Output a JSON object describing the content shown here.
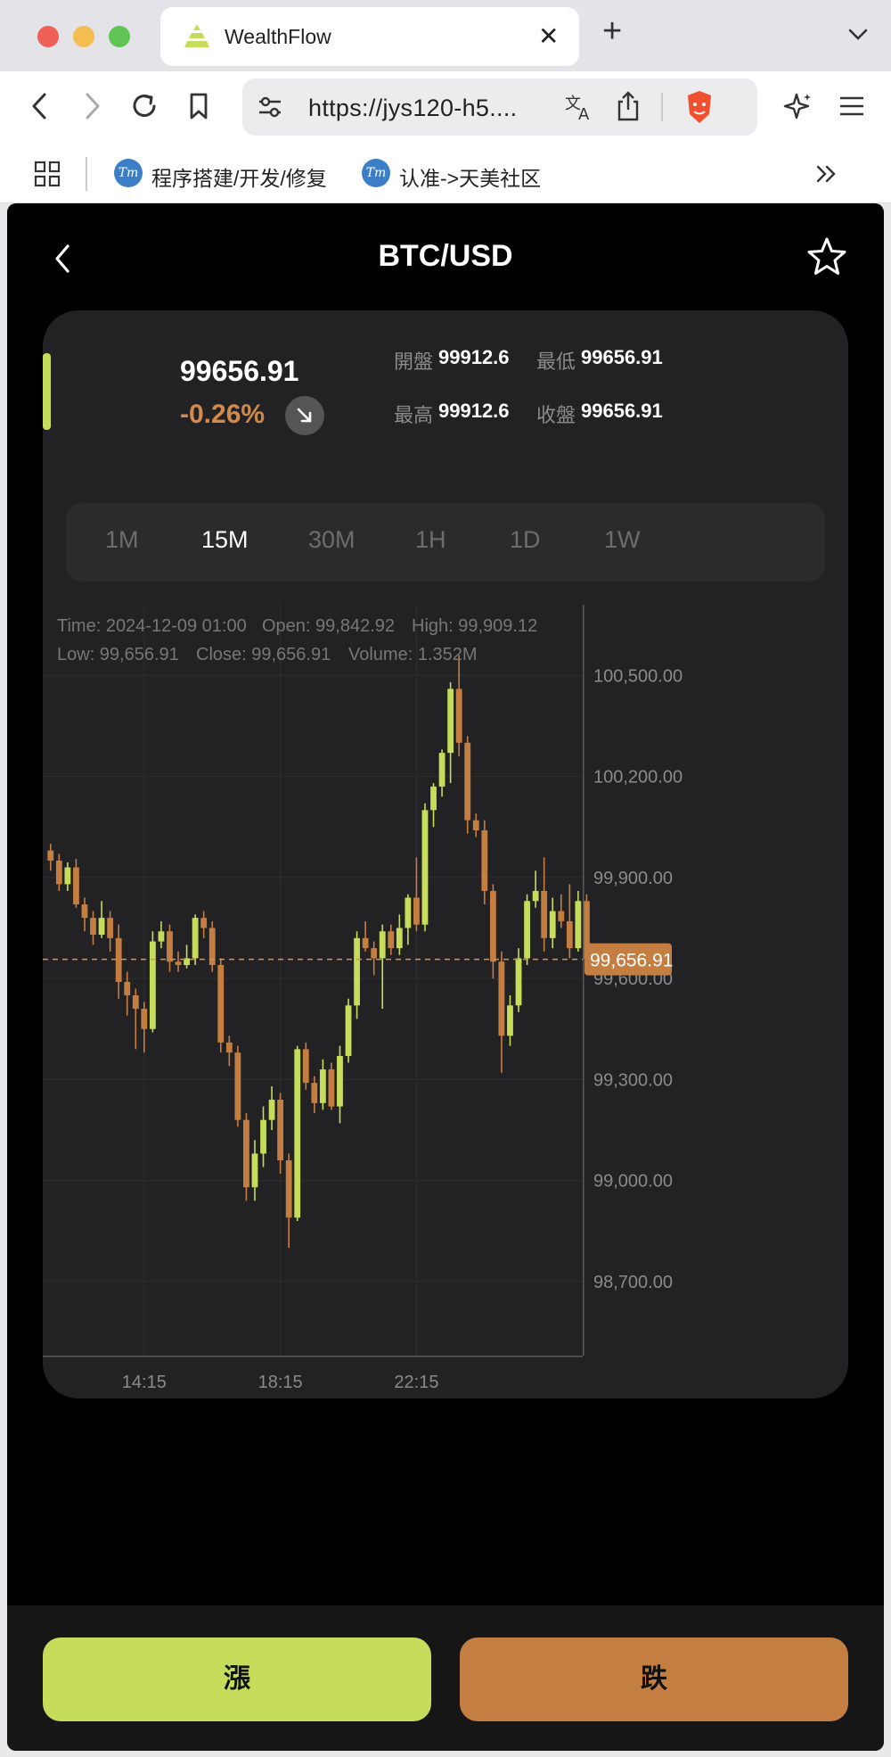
{
  "browser": {
    "tab_title": "WealthFlow",
    "url": "https://jys120-h5....",
    "bookmarks": [
      "程序搭建/开发/修复",
      "认准->天美社区"
    ],
    "bookmark_icon_text": "Tm"
  },
  "header": {
    "title": "BTC/USD"
  },
  "ticker": {
    "price": "99656.91",
    "change_pct": "-0.26%",
    "open_label": "開盤",
    "open_value": "99912.6",
    "low_label": "最低",
    "low_value": "99656.91",
    "high_label": "最高",
    "high_value": "99912.6",
    "close_label": "收盤",
    "close_value": "99656.91",
    "up_color": "#c5dd5a",
    "down_color": "#c57e42"
  },
  "timeframes": [
    "1M",
    "15M",
    "30M",
    "1H",
    "1D",
    "1W"
  ],
  "active_timeframe": "15M",
  "chart_info": {
    "time": "Time: 2024-12-09 01:00",
    "open": "Open: 99,842.92",
    "high": "High: 99,909.12",
    "low": "Low: 99,656.91",
    "close": "Close: 99,656.91",
    "volume": "Volume: 1.352M"
  },
  "chart_data": {
    "type": "candlestick",
    "y_ticks": [
      "100,500.00",
      "100,200.00",
      "99,900.00",
      "99,600.00",
      "99,300.00",
      "99,000.00",
      "98,700.00"
    ],
    "x_ticks": [
      "14:15",
      "18:15",
      "22:15"
    ],
    "ylim": [
      98480,
      100710
    ],
    "last_price": 99656.91,
    "last_price_label": "99,656.91",
    "candles": [
      [
        99980,
        99950,
        100000,
        99920
      ],
      [
        99950,
        99880,
        99970,
        99860
      ],
      [
        99880,
        99930,
        99945,
        99860
      ],
      [
        99930,
        99820,
        99955,
        99810
      ],
      [
        99820,
        99780,
        99840,
        99740
      ],
      [
        99780,
        99730,
        99800,
        99700
      ],
      [
        99730,
        99780,
        99830,
        99720
      ],
      [
        99780,
        99720,
        99800,
        99680
      ],
      [
        99720,
        99590,
        99760,
        99540
      ],
      [
        99590,
        99550,
        99620,
        99490
      ],
      [
        99550,
        99510,
        99570,
        99390
      ],
      [
        99510,
        99450,
        99530,
        99380
      ],
      [
        99450,
        99710,
        99740,
        99440
      ],
      [
        99710,
        99740,
        99770,
        99690
      ],
      [
        99740,
        99650,
        99760,
        99620
      ],
      [
        99650,
        99640,
        99680,
        99620
      ],
      [
        99640,
        99660,
        99700,
        99630
      ],
      [
        99660,
        99780,
        99790,
        99640
      ],
      [
        99780,
        99750,
        99800,
        99720
      ],
      [
        99750,
        99640,
        99770,
        99620
      ],
      [
        99640,
        99410,
        99660,
        99380
      ],
      [
        99410,
        99380,
        99430,
        99340
      ],
      [
        99380,
        99180,
        99400,
        99160
      ],
      [
        99180,
        98980,
        99200,
        98940
      ],
      [
        98980,
        99080,
        99120,
        98940
      ],
      [
        99080,
        99180,
        99220,
        99040
      ],
      [
        99180,
        99240,
        99280,
        99150
      ],
      [
        99240,
        99060,
        99260,
        99020
      ],
      [
        99060,
        98890,
        99080,
        98800
      ],
      [
        98890,
        99390,
        99400,
        98880
      ],
      [
        99390,
        99290,
        99410,
        99270
      ],
      [
        99290,
        99230,
        99310,
        99200
      ],
      [
        99230,
        99330,
        99360,
        99210
      ],
      [
        99330,
        99220,
        99350,
        99210
      ],
      [
        99220,
        99370,
        99400,
        99170
      ],
      [
        99370,
        99520,
        99540,
        99350
      ],
      [
        99520,
        99720,
        99740,
        99480
      ],
      [
        99720,
        99690,
        99770,
        99680
      ],
      [
        99690,
        99660,
        99710,
        99610
      ],
      [
        99660,
        99740,
        99760,
        99510
      ],
      [
        99740,
        99690,
        99760,
        99670
      ],
      [
        99690,
        99750,
        99790,
        99670
      ],
      [
        99750,
        99840,
        99850,
        99700
      ],
      [
        99840,
        99760,
        99960,
        99740
      ],
      [
        99760,
        100100,
        100120,
        99740
      ],
      [
        100100,
        100170,
        100180,
        100050
      ],
      [
        100170,
        100270,
        100280,
        100140
      ],
      [
        100270,
        100460,
        100480,
        100180
      ],
      [
        100460,
        100300,
        100560,
        100260
      ],
      [
        100300,
        100070,
        100320,
        100030
      ],
      [
        100070,
        100040,
        100090,
        100020
      ],
      [
        100040,
        99860,
        100070,
        99820
      ],
      [
        99860,
        99650,
        99880,
        99600
      ],
      [
        99650,
        99430,
        99680,
        99320
      ],
      [
        99430,
        99520,
        99550,
        99400
      ],
      [
        99520,
        99660,
        99690,
        99500
      ],
      [
        99660,
        99830,
        99850,
        99640
      ],
      [
        99830,
        99860,
        99920,
        99810
      ],
      [
        99860,
        99720,
        99960,
        99680
      ],
      [
        99720,
        99800,
        99840,
        99690
      ],
      [
        99800,
        99770,
        99850,
        99750
      ],
      [
        99770,
        99690,
        99880,
        99660
      ],
      [
        99690,
        99830,
        99860,
        99680
      ],
      [
        99830,
        99656.91,
        99850,
        99640
      ]
    ]
  },
  "actions": {
    "up_label": "漲",
    "down_label": "跌"
  }
}
